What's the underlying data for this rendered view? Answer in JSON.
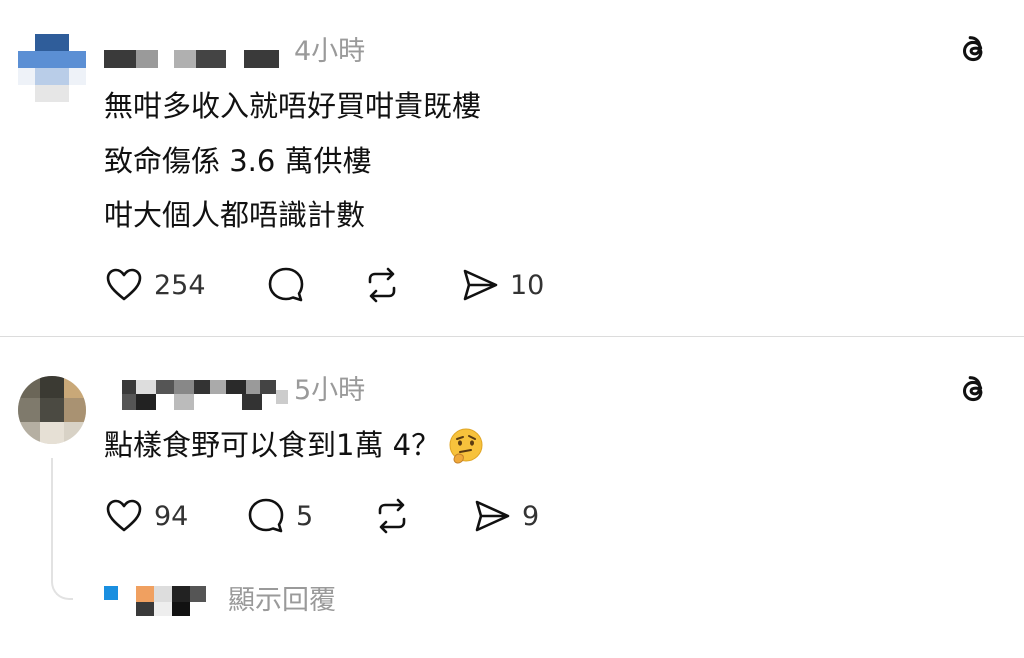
{
  "posts": [
    {
      "time": "4小時",
      "lines": [
        "無咁多收入就唔好買咁貴既樓",
        "致命傷係 3.6 萬供樓",
        "咁大個人都唔識計數"
      ],
      "likes": "254",
      "replies": "",
      "shares": "10",
      "icons": [
        "heart-icon",
        "comment-icon",
        "repost-icon",
        "send-icon",
        "threads-icon"
      ]
    },
    {
      "time": "5小時",
      "lines": [
        "點樣食野可以食到1萬 4？"
      ],
      "emoji": "thinking-face-emoji",
      "likes": "94",
      "replies": "5",
      "shares": "9",
      "icons": [
        "heart-icon",
        "comment-icon",
        "repost-icon",
        "send-icon",
        "threads-icon"
      ]
    }
  ],
  "show_replies": "顯示回覆",
  "colors": {
    "text": "#111111",
    "muted": "#9a9a9a",
    "divider": "#dcdcdc"
  }
}
